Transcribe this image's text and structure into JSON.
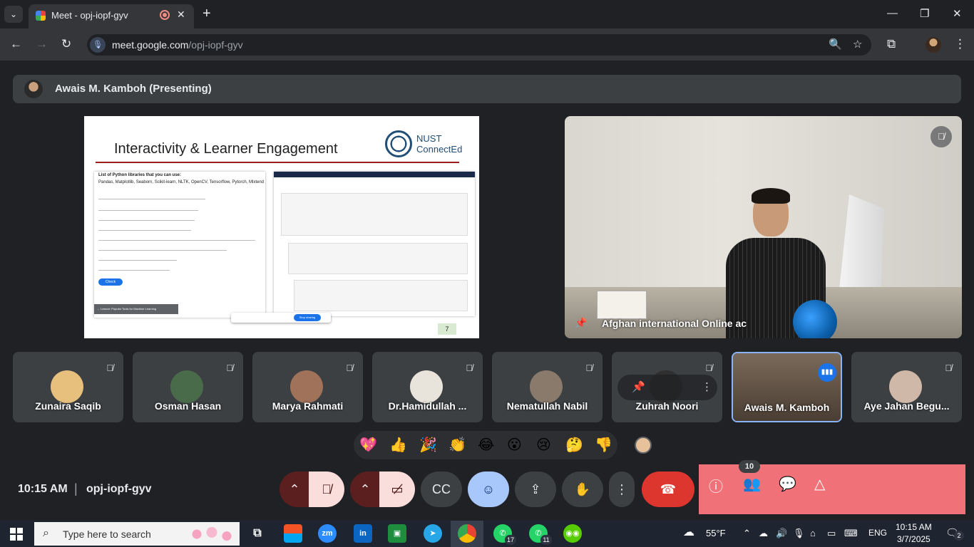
{
  "browser": {
    "tab_title": "Meet - opj-iopf-gyv",
    "tab_close": "✕",
    "new_tab": "+",
    "url_host": "meet.google.com",
    "url_path": "/opj-iopf-gyv",
    "window_controls": [
      "—",
      "❐",
      "✕"
    ]
  },
  "meet": {
    "presenting_label": "Awais M. Kamboh (Presenting)",
    "slide": {
      "title": "Interactivity & Learner Engagement",
      "logo_line1": "NUST",
      "logo_line2": "ConnectEd",
      "left_header": "List of Python libraries that you can use:",
      "left_sub": "Pandas, Matplotlib, Seaborn, Scikit-learn, NLTK, OpenCV, Tensorflow, Pytorch, Mlxtend",
      "check_button": "Check",
      "footer_text": "← Lesson: Popular Tools for Machine Learning",
      "stop_sharing": "Stop sharing",
      "page_number": "7"
    },
    "main_video": {
      "name": "Afghan international Online ac"
    },
    "participants": [
      {
        "name": "Zunaira Saqib",
        "color": "#e8c07d"
      },
      {
        "name": "Osman Hasan",
        "color": "#4a6b4a"
      },
      {
        "name": "Marya Rahmati",
        "color": "#a0725a"
      },
      {
        "name": "Dr.Hamidullah ...",
        "color": "#e8e4dc"
      },
      {
        "name": "Nematullah Nabil",
        "color": "#8a7a6c"
      },
      {
        "name": "Zuhrah Noori",
        "color": "#2f2f2f"
      },
      {
        "name": "Awais M. Kamboh",
        "color": "#6b5a4a"
      },
      {
        "name": "Aye Jahan Begu...",
        "color": "#d0b8a8"
      }
    ],
    "reactions": [
      "💖",
      "👍",
      "🎉",
      "👏",
      "😂",
      "😮",
      "😢",
      "🤔",
      "👎"
    ],
    "time": "10:15 AM",
    "separator": "|",
    "meeting_code": "opj-iopf-gyv",
    "people_count": "10"
  },
  "taskbar": {
    "search_placeholder": "Type here to search",
    "weather_temp": "55°F",
    "language": "ENG",
    "clock_time": "10:15 AM",
    "clock_date": "3/7/2025",
    "whatsapp_badge_1": "17",
    "whatsapp_badge_2": "11",
    "notification_badge": "2",
    "zoom_label": "zm",
    "linkedin_label": "in"
  }
}
